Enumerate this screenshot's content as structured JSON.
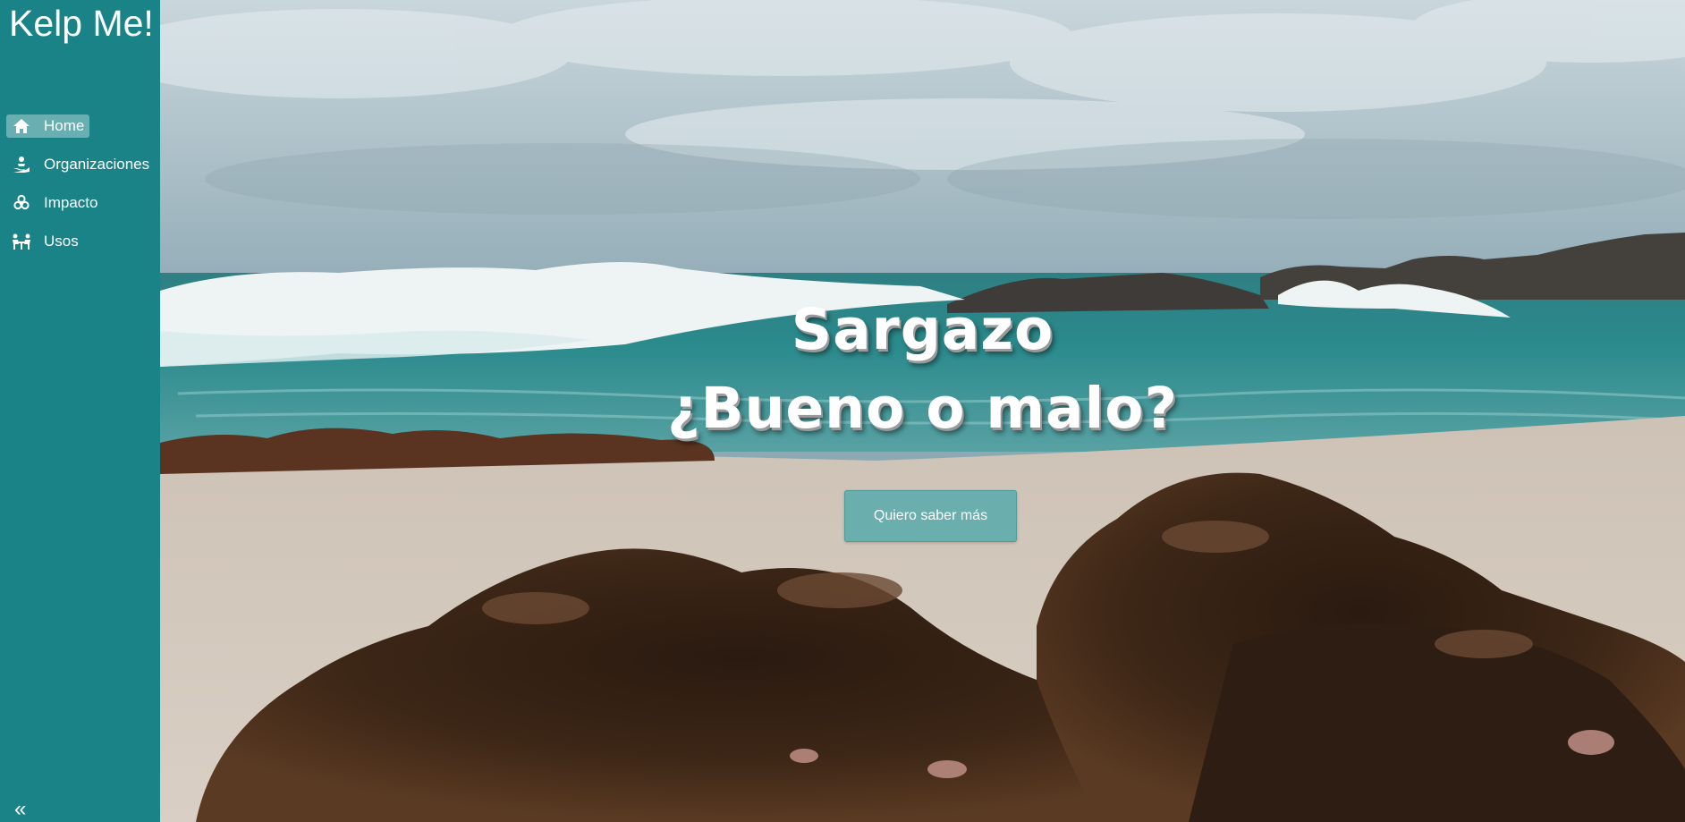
{
  "sidebar": {
    "brand": "Kelp Me!",
    "items": [
      {
        "label": "Home",
        "icon": "home-icon",
        "active": true
      },
      {
        "label": "Organizaciones",
        "icon": "hand-holding-person-icon",
        "active": false
      },
      {
        "label": "Impacto",
        "icon": "biohazard-icon",
        "active": false
      },
      {
        "label": "Usos",
        "icon": "people-at-table-icon",
        "active": false
      }
    ],
    "collapse_glyph": "«"
  },
  "hero": {
    "title_line1": "Sargazo",
    "title_line2": "¿Bueno o malo?",
    "cta_label": "Quiero saber más",
    "background": "beach-with-seaweed-and-waves-photo"
  },
  "colors": {
    "sidebar": "#1a8387",
    "button": "#6aaeae",
    "active_item": "rgba(255,255,255,0.35)"
  }
}
